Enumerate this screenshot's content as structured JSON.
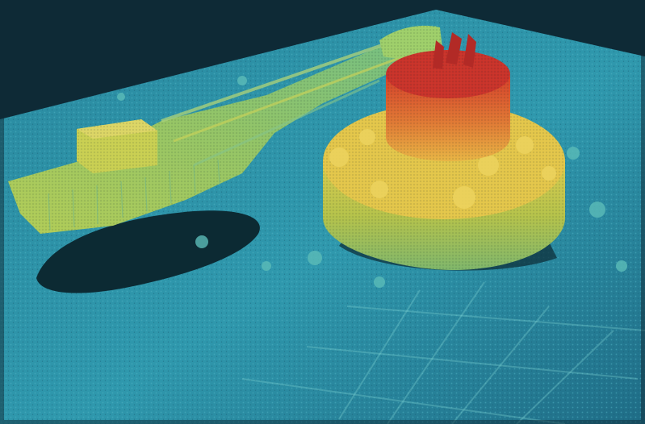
{
  "image": {
    "subject": "multibeam-sonar-point-cloud",
    "colors": {
      "background": "#0e2a36",
      "seabed_deep": "#1e6f86",
      "seabed_mid": "#2d93a8",
      "seabed_light": "#56b7c0",
      "low_structure": "#7fc27a",
      "mid_structure": "#c7cf4c",
      "high_structure": "#e7a43a",
      "top_structure": "#d8542a",
      "shadow": "#0b2530"
    }
  }
}
